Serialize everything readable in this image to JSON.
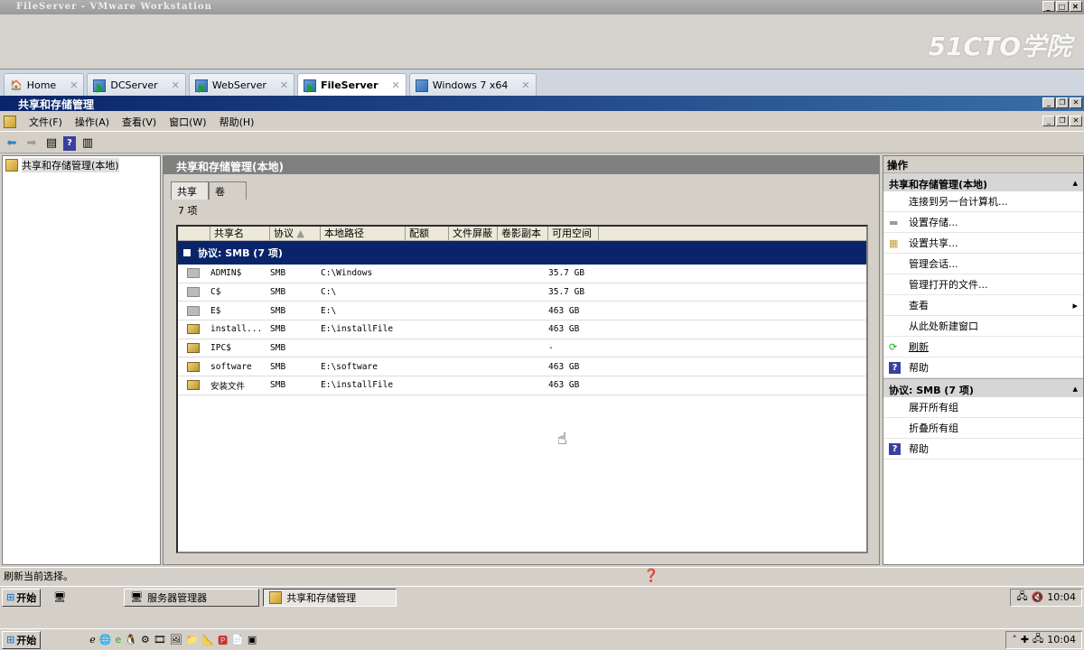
{
  "vmware": {
    "title": "FileServer - VMware Workstation",
    "watermark": "51CTO学院",
    "tabs": [
      {
        "label": "Home"
      },
      {
        "label": "DCServer"
      },
      {
        "label": "WebServer"
      },
      {
        "label": "FileServer"
      },
      {
        "label": "Windows 7 x64"
      }
    ]
  },
  "mmc": {
    "title": "共享和存储管理",
    "menu": [
      "文件(F)",
      "操作(A)",
      "查看(V)",
      "窗口(W)",
      "帮助(H)"
    ]
  },
  "tree": {
    "root": "共享和存储管理(本地)"
  },
  "center": {
    "header": "共享和存储管理(本地)",
    "tabs": [
      "共享",
      "卷"
    ],
    "count": "7 项",
    "columns": [
      "共享名",
      "协议",
      "本地路径",
      "配额",
      "文件屏蔽",
      "卷影副本",
      "可用空间"
    ],
    "group": "协议: SMB (7 项)",
    "rows": [
      {
        "name": "ADMIN$",
        "protocol": "SMB",
        "path": "C:\\Windows",
        "free": "35.7 GB",
        "icon": "hidden-share"
      },
      {
        "name": "C$",
        "protocol": "SMB",
        "path": "C:\\",
        "free": "35.7 GB",
        "icon": "hidden-share"
      },
      {
        "name": "E$",
        "protocol": "SMB",
        "path": "E:\\",
        "free": "463 GB",
        "icon": "hidden-share"
      },
      {
        "name": "install...",
        "protocol": "SMB",
        "path": "E:\\installFile",
        "free": "463 GB",
        "icon": "share"
      },
      {
        "name": "IPC$",
        "protocol": "SMB",
        "path": "",
        "free": "-",
        "icon": "share"
      },
      {
        "name": "software",
        "protocol": "SMB",
        "path": "E:\\software",
        "free": "463 GB",
        "icon": "share"
      },
      {
        "name": "安装文件",
        "protocol": "SMB",
        "path": "E:\\installFile",
        "free": "463 GB",
        "icon": "share"
      }
    ]
  },
  "actions": {
    "header": "操作",
    "section1": "共享和存储管理(本地)",
    "items1": [
      "连接到另一台计算机...",
      "设置存储...",
      "设置共享...",
      "管理会话...",
      "管理打开的文件...",
      "查看",
      "从此处新建窗口",
      "刷新",
      "帮助"
    ],
    "section2": "协议: SMB (7 项)",
    "items2": [
      "展开所有组",
      "折叠所有组",
      "帮助"
    ]
  },
  "status": {
    "text": "刷新当前选择。"
  },
  "inner_taskbar": {
    "start": "开始",
    "tasks": [
      "服务器管理器",
      "共享和存储管理"
    ],
    "clock": "10:04"
  },
  "outer_taskbar": {
    "start": "开始",
    "clock": "10:04"
  }
}
